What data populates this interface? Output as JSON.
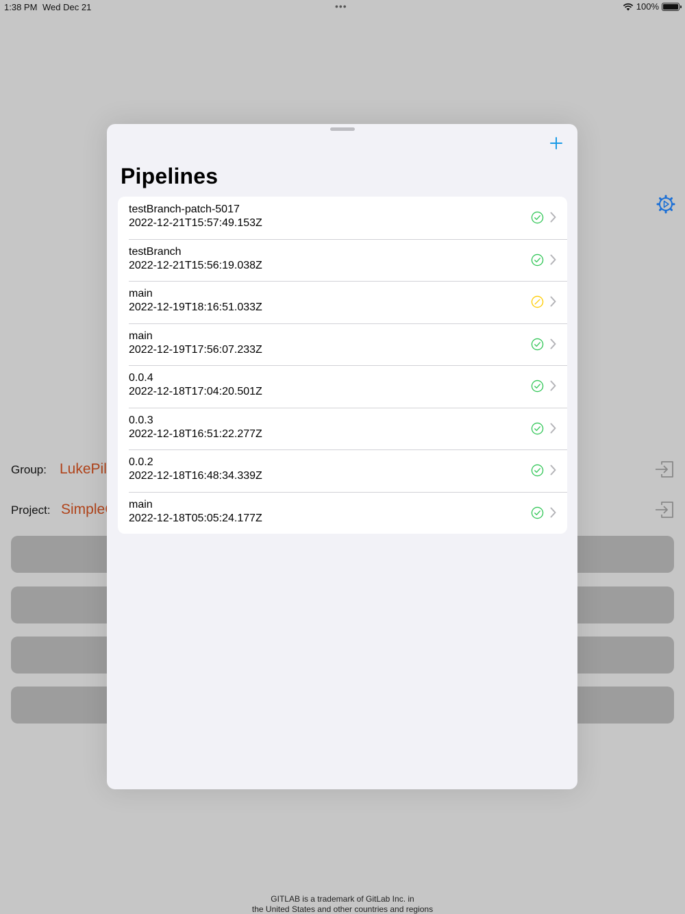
{
  "status_bar": {
    "time": "1:38 PM",
    "date": "Wed Dec 21",
    "battery": "100%"
  },
  "background": {
    "group_label": "Group:",
    "group_value": "LukePill",
    "project_label": "Project:",
    "project_value": "SimpleC",
    "footer_line1": "GITLAB is a trademark of GitLab Inc. in",
    "footer_line2": "the United States and other countries and regions"
  },
  "sheet": {
    "title": "Pipelines",
    "add_icon": "plus-icon",
    "rows": [
      {
        "branch": "testBranch-patch-5017",
        "date": "2022-12-21T15:57:49.153Z",
        "status": "success"
      },
      {
        "branch": "testBranch",
        "date": "2022-12-21T15:56:19.038Z",
        "status": "success"
      },
      {
        "branch": "main",
        "date": "2022-12-19T18:16:51.033Z",
        "status": "skipped"
      },
      {
        "branch": "main",
        "date": "2022-12-19T17:56:07.233Z",
        "status": "success"
      },
      {
        "branch": "0.0.4",
        "date": "2022-12-18T17:04:20.501Z",
        "status": "success"
      },
      {
        "branch": "0.0.3",
        "date": "2022-12-18T16:51:22.277Z",
        "status": "success"
      },
      {
        "branch": "0.0.2",
        "date": "2022-12-18T16:48:34.339Z",
        "status": "success"
      },
      {
        "branch": "main",
        "date": "2022-12-18T05:05:24.177Z",
        "status": "success"
      }
    ]
  },
  "colors": {
    "success": "#34c759",
    "skipped": "#ffcc00",
    "accent": "#1a9be6",
    "group_text": "#b0431a"
  }
}
